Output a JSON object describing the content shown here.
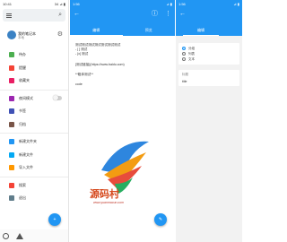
{
  "colors": {
    "accent": "#2196F3",
    "fab": "#2196F3"
  },
  "panel1": {
    "status_time": "10:41",
    "status_right": "34 ⊿ ▮",
    "profile": {
      "name": "我的笔记本",
      "sub": "本地"
    },
    "menu": [
      {
        "label": "待办",
        "icon": "todo-icon",
        "color": "#4caf50"
      },
      {
        "label": "提醒",
        "icon": "alarm-icon",
        "color": "#f44336"
      },
      {
        "label": "收藏夹",
        "icon": "star-icon",
        "color": "#e91e63"
      },
      {
        "label": "夜间模式",
        "icon": "moon-icon",
        "color": "#9c27b0",
        "toggle": true
      },
      {
        "label": "书签",
        "icon": "bookmark-icon",
        "color": "#3f51b5"
      },
      {
        "label": "归档",
        "icon": "archive-icon",
        "color": "#795548"
      },
      {
        "label": "新建文件夹",
        "icon": "folder-add-icon",
        "color": "#2196F3"
      },
      {
        "label": "新建文件",
        "icon": "file-add-icon",
        "color": "#03a9f4"
      },
      {
        "label": "导入文件",
        "icon": "import-icon",
        "color": "#ff9800"
      },
      {
        "label": "搜索",
        "icon": "search-icon",
        "color": "#f44336"
      },
      {
        "label": "退出",
        "icon": "exit-icon",
        "color": "#607d8b"
      }
    ],
    "fab": "+"
  },
  "panel2": {
    "status_time": "1:56",
    "status_right": "⊿ ▮",
    "tabs": [
      "编辑",
      "预览"
    ],
    "content": {
      "line1": "测试测试测试测试测试测试测试",
      "line2": "- [ ] 测试",
      "line3": "- [x] 测试",
      "line4": "[测试链接](https://www.baidu.com)",
      "line5": "**粗体测试**",
      "line6": "code"
    },
    "watermark": {
      "text": "源码村",
      "url": "www.yuanmacun.com"
    },
    "fab": "✎"
  },
  "panel3": {
    "status_time": "1:56",
    "status_right": "⊿ ▮",
    "title": "编辑",
    "options": [
      "分组",
      "列表",
      "文本"
    ],
    "field_label": "标题",
    "field_value": "title"
  }
}
